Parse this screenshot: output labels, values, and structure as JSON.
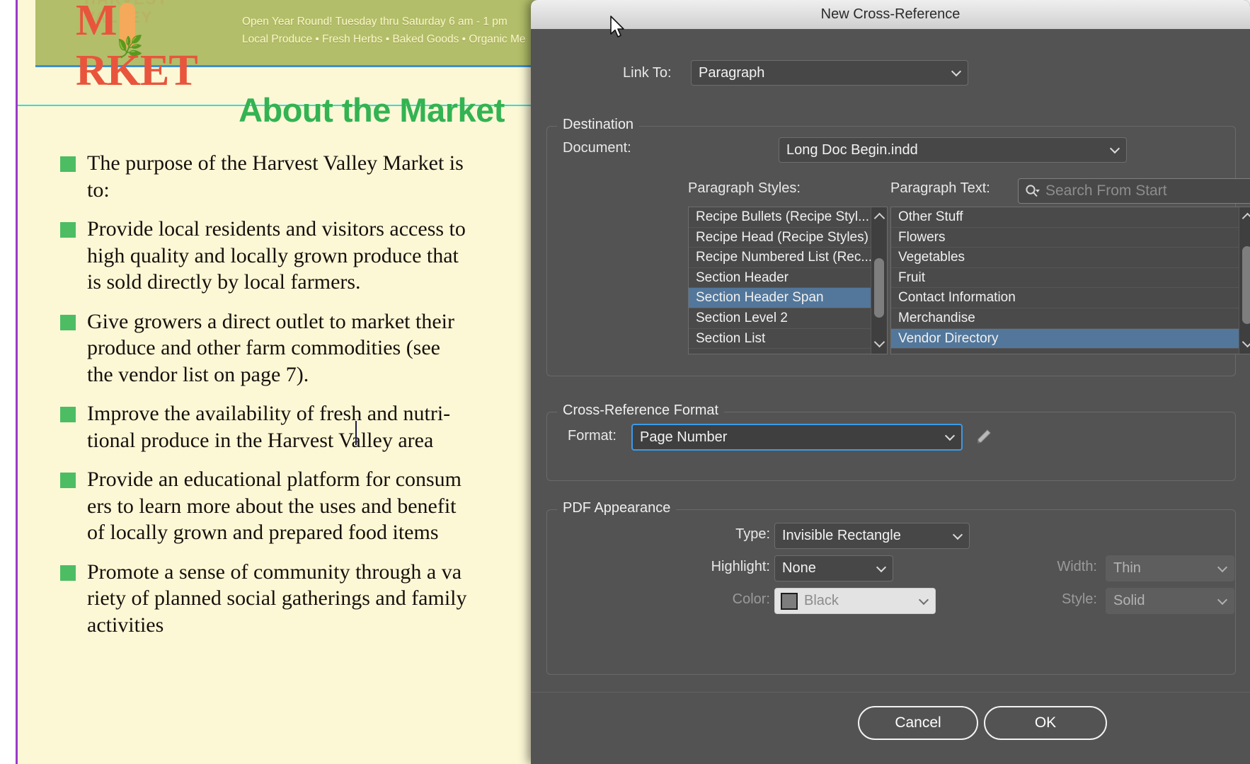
{
  "document": {
    "banner": {
      "logo_top": "HARVEST VALLEY",
      "logo_main": "M RKET",
      "tagline_line1": "Open Year Round! Tuesday thru Saturday 6 am - 1 pm",
      "tagline_line2": "Local Produce • Fresh Herbs • Baked Goods • Organic Me"
    },
    "title": "About the Market",
    "bullets": [
      "The purpose of the Harvest Valley Market is\nto:",
      "Provide local residents and visitors access to\nhigh quality and locally grown produce that\nis sold directly by local farmers.",
      "Give growers a direct outlet to market their\nproduce and other farm commodities (see\nthe vendor list on page 7).",
      "Improve the availability of fresh and nutri-\ntional produce in the Harvest Valley area",
      "Provide an educational platform for consum\ners to learn more about the uses and benefit\nof locally grown and prepared food items",
      "Promote a sense of community through a va\nriety of planned social gatherings and family\nactivities"
    ],
    "colors": {
      "banner_bg": "#b2be69",
      "page_bg": "#fcf8d6",
      "title_green": "#33b352",
      "bullet_green": "#4cbd63",
      "logo_red": "#e8553c",
      "guide_cyan": "#2ce0e0",
      "margin_purple": "#9b39c9"
    }
  },
  "dialog": {
    "title": "New Cross-Reference",
    "link_to": {
      "label": "Link To:",
      "value": "Paragraph"
    },
    "destination": {
      "legend": "Destination",
      "document_label": "Document:",
      "document_value": "Long Doc Begin.indd",
      "paragraph_styles_label": "Paragraph Styles:",
      "paragraph_text_label": "Paragraph Text:",
      "search_placeholder": "Search From Start",
      "search_value": "",
      "paragraph_styles": [
        {
          "label": "Recipe Bullets (Recipe Styl...",
          "selected": false
        },
        {
          "label": "Recipe Head (Recipe Styles)",
          "selected": false
        },
        {
          "label": "Recipe Numbered List (Rec...",
          "selected": false
        },
        {
          "label": "Section Header",
          "selected": false
        },
        {
          "label": "Section Header Span",
          "selected": true
        },
        {
          "label": "Section Level 2",
          "selected": false
        },
        {
          "label": "Section List",
          "selected": false
        }
      ],
      "paragraph_text": [
        {
          "label": "Other Stuff",
          "selected": false
        },
        {
          "label": "Flowers",
          "selected": false
        },
        {
          "label": "Vegetables",
          "selected": false
        },
        {
          "label": "Fruit",
          "selected": false
        },
        {
          "label": "Contact Information",
          "selected": false
        },
        {
          "label": "Merchandise",
          "selected": false
        },
        {
          "label": "Vendor Directory",
          "selected": true
        }
      ]
    },
    "xref_format": {
      "legend": "Cross-Reference Format",
      "format_label": "Format:",
      "format_value": "Page Number"
    },
    "pdf_appearance": {
      "legend": "PDF Appearance",
      "type_label": "Type:",
      "type_value": "Invisible Rectangle",
      "highlight_label": "Highlight:",
      "highlight_value": "None",
      "color_label": "Color:",
      "color_value": "Black",
      "color_swatch": "#7d7d7d",
      "width_label": "Width:",
      "width_value": "Thin",
      "style_label": "Style:",
      "style_value": "Solid"
    },
    "buttons": {
      "cancel": "Cancel",
      "ok": "OK"
    },
    "accent": "#3c9ae8",
    "selection": "#52779b"
  }
}
